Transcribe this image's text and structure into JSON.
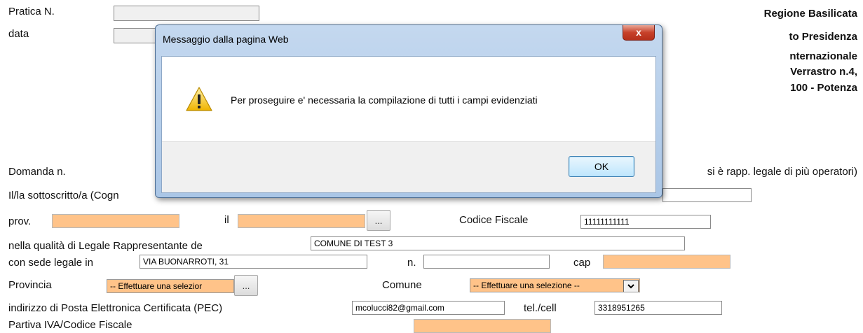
{
  "header": {
    "pratica_label": "Pratica N.",
    "data_label": "data",
    "org": [
      "Regione Basilicata",
      "to Presidenza",
      "nternazionale",
      "Verrastro n.4,",
      "100 - Potenza"
    ]
  },
  "form": {
    "domanda_label": "Domanda n.",
    "domanda_note": "si è rapp. legale di più operatori)",
    "sottoscritto_label": "Il/la sottoscritto/a (Cogn",
    "prov_label": "prov.",
    "il_label": "il",
    "dots": "...",
    "cf_label": "Codice Fiscale",
    "cf_value": "11111111111",
    "qualita_label": "nella qualità di Legale Rappresentante de",
    "qualita_value": "COMUNE DI TEST 3",
    "sede_label": "con sede legale in",
    "sede_value": "VIA BUONARROTI, 31",
    "n_label": "n.",
    "cap_label": "cap",
    "provincia_label": "Provincia",
    "provincia_select": "-- Effettuare una selezior",
    "comune_label": "Comune",
    "comune_select": "-- Effettuare una selezione --",
    "pec_label": "indirizzo di Posta Elettronica Certificata (PEC)",
    "pec_value": "mcolucci82@gmail.com",
    "tel_label": "tel./cell",
    "tel_value": "3318951265",
    "piva_label": "Partiva IVA/Codice Fiscale"
  },
  "dialog": {
    "title": "Messaggio dalla pagina Web",
    "close": "x",
    "message": "Per proseguire e' necessaria la compilazione di tutti i campi evidenziati",
    "ok": "OK",
    "icon": "warning-icon"
  },
  "colors": {
    "required_field": "#ffc389",
    "dialog_frame": "#aac6e6"
  }
}
